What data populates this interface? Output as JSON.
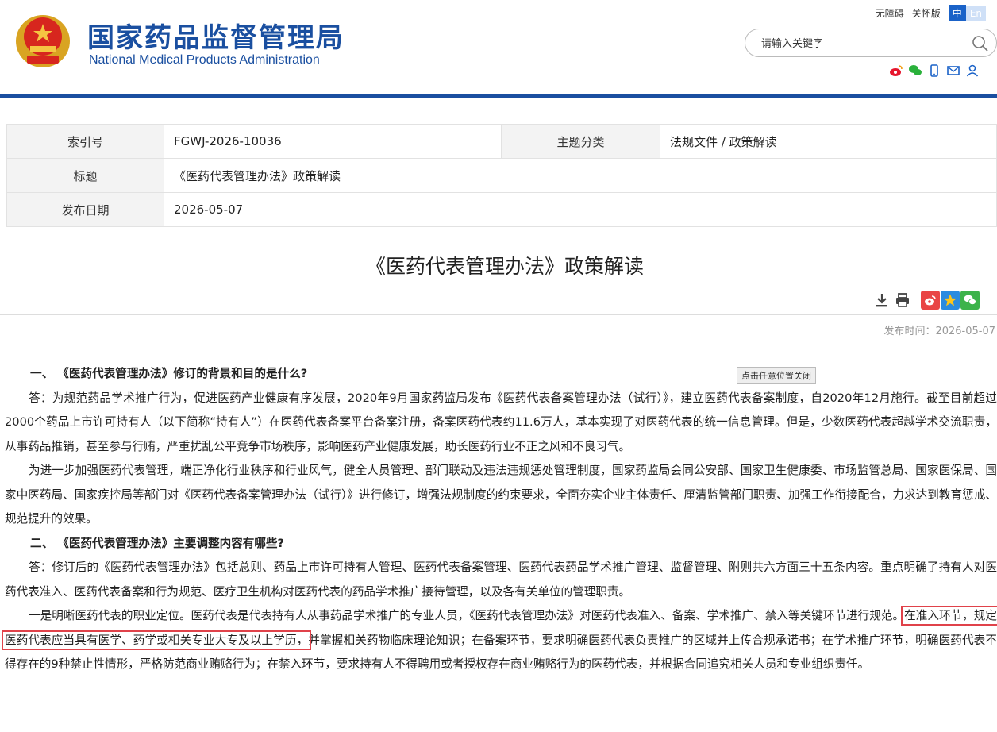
{
  "header": {
    "title": "国家药品监督管理局",
    "subtitle": "National Medical Products Administration",
    "links": {
      "accessible": "无障碍",
      "care": "关怀版"
    },
    "lang": {
      "zh": "中",
      "en": "En"
    },
    "search": {
      "placeholder": "请输入关键字"
    },
    "social_icons": [
      "weibo-icon",
      "wechat-icon",
      "mobile-icon",
      "mail-icon",
      "user-icon"
    ]
  },
  "info": {
    "index_label": "索引号",
    "index_value": "FGWJ-2026-10036",
    "category_label": "主题分类",
    "category_value": "法规文件 / 政策解读",
    "title_label": "标题",
    "title_value": "《医药代表管理办法》政策解读",
    "date_label": "发布日期",
    "date_value": "2026-05-07"
  },
  "article": {
    "title": "《医药代表管理办法》政策解读",
    "pubtime": "发布时间：2026-05-07",
    "close_tip": "点击任意位置关闭",
    "q1": "一、 《医药代表管理办法》修订的背景和目的是什么?",
    "p1": "答：为规范药品学术推广行为，促进医药产业健康有序发展，2020年9月国家药监局发布《医药代表备案管理办法（试行）》，建立医药代表备案制度，自2020年12月施行。截至目前超过2000个药品上市许可持有人（以下简称“持有人”）在医药代表备案平台备案注册，备案医药代表约11.6万人，基本实现了对医药代表的统一信息管理。但是，少数医药代表超越学术交流职责，从事药品推销，甚至参与行贿，严重扰乱公平竞争市场秩序，影响医药产业健康发展，助长医药行业不正之风和不良习气。",
    "p2": "为进一步加强医药代表管理，端正净化行业秩序和行业风气，健全人员管理、部门联动及违法违规惩处管理制度，国家药监局会同公安部、国家卫生健康委、市场监管总局、国家医保局、国家中医药局、国家疾控局等部门对《医药代表备案管理办法（试行）》进行修订，增强法规制度的约束要求，全面夯实企业主体责任、厘清监管部门职责、加强工作衔接配合，力求达到教育惩戒、规范提升的效果。",
    "q2": "二、 《医药代表管理办法》主要调整内容有哪些?",
    "p3": "答：修订后的《医药代表管理办法》包括总则、药品上市许可持有人管理、医药代表备案管理、医药代表药品学术推广管理、监督管理、附则共六方面三十五条内容。重点明确了持有人对医药代表准入、医药代表备案和行为规范、医疗卫生机构对医药代表的药品学术推广接待管理，以及各有关单位的管理职责。",
    "p4_a": "一是明晰医药代表的职业定位。医药代表是代表持有人从事药品学术推广的专业人员，《医药代表管理办法》对医药代表准入、备案、学术推广、禁入等关键环节进行规范。",
    "p4_highlight": "在准入环节，规定医药代表应当具有医学、药学或相关专业大专及以上学历，",
    "p4_b": "并掌握相关药物临床理论知识；在备案环节，要求明确医药代表负责推广的区域并上传合规承诺书；在学术推广环节，明确医药代表不得存在的9种禁止性情形，严格防范商业贿赂行为；在禁入环节，要求持有人不得聘用或者授权存在商业贿赂行为的医药代表，并根据合同追究相关人员和专业组织责任。"
  },
  "colors": {
    "brand": "#1a4fa0",
    "highlight": "#e0424a"
  }
}
